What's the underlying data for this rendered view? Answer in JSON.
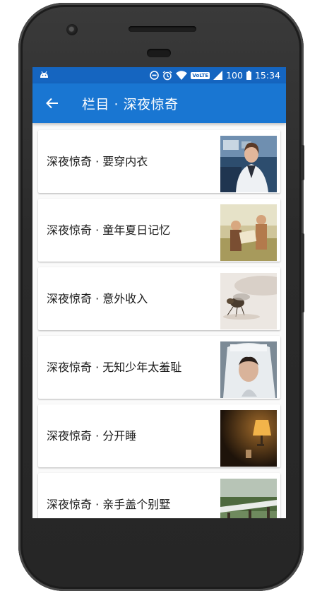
{
  "status_bar": {
    "battery": "100",
    "time": "15:34",
    "volte_badge": "VoLTE",
    "icons": [
      "android-app-icon",
      "do-not-disturb-icon",
      "alarm-icon",
      "wifi-icon",
      "volte-icon",
      "cell-signal-icon",
      "battery-icon"
    ]
  },
  "app_bar": {
    "back_icon": "arrow-back-icon",
    "title": "栏目 · 深夜惊奇"
  },
  "articles": [
    {
      "title": "深夜惊奇 · 要穿内衣",
      "thumb": "woman-lab-photo"
    },
    {
      "title": "深夜惊奇 · 童年夏日记忆",
      "thumb": "kids-field-photo"
    },
    {
      "title": "深夜惊奇 · 意外收入",
      "thumb": "fly-photo"
    },
    {
      "title": "深夜惊奇 · 无知少年太羞耻",
      "thumb": "veiled-woman-photo"
    },
    {
      "title": "深夜惊奇 · 分开睡",
      "thumb": "wall-lamp-photo"
    },
    {
      "title": "深夜惊奇 · 亲手盖个别墅",
      "thumb": "garden-photo"
    }
  ],
  "colors": {
    "status_bar": "#1565c0",
    "app_bar": "#1976d2",
    "background": "#fafafa"
  }
}
